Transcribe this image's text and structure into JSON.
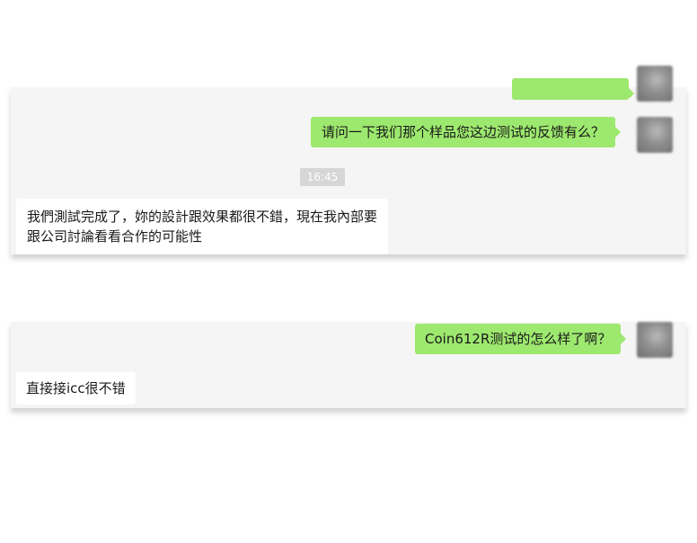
{
  "chat1": {
    "messages": [
      {
        "direction": "out",
        "text": ""
      },
      {
        "direction": "out",
        "text": "请问一下我们那个样品您这边测试的反馈有么？"
      },
      {
        "direction": "time",
        "text": "16:45"
      },
      {
        "direction": "in",
        "lines": [
          "我們測試完成了，妳的設計跟效果都很不錯，現在我內部要",
          "跟公司討論看看合作的可能性"
        ]
      }
    ]
  },
  "chat2": {
    "messages": [
      {
        "direction": "out",
        "text": "Coin612R测试的怎么样了啊？"
      },
      {
        "direction": "in",
        "text": "直接接icc很不错"
      }
    ]
  },
  "colors": {
    "outgoing_bubble": "#9de86e",
    "incoming_bubble": "#ffffff",
    "panel_background": "#f5f5f5",
    "timestamp_background": "#d6d6d6"
  }
}
